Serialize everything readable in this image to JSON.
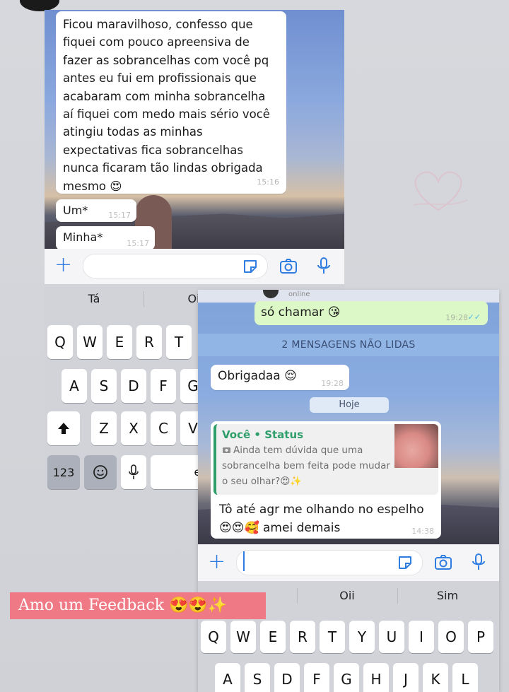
{
  "screenshot1": {
    "messages": [
      {
        "text": "Ficou maravilhoso, confesso que fiquei com pouco apreensiva de fazer as sobrancelhas com você pq antes eu fui em profissionais que acabaram com minha sobrancelha aí fiquei com medo mais sério você atingiu todas as minhas expectativas fica sobrancelhas nunca ficaram tão lindas obrigada mesmo 😍",
        "time": "15:16"
      },
      {
        "text": "Um*",
        "time": "15:17"
      },
      {
        "text": "Minha*",
        "time": "15:17"
      }
    ],
    "suggestions": [
      "Tá",
      "Oi"
    ],
    "keys_row1": [
      "Q",
      "W",
      "E",
      "R",
      "T"
    ],
    "keys_row2": [
      "A",
      "S",
      "D",
      "F",
      "G"
    ],
    "keys_row3": [
      "Z",
      "X",
      "C",
      "V"
    ],
    "key_123": "123",
    "key_space_partial": "es"
  },
  "screenshot2": {
    "header_status": "online",
    "outgoing": {
      "text": "só chamar 😘",
      "time": "19:28",
      "ticks": "✓✓"
    },
    "unread_banner": "2 MENSAGENS NÃO LIDAS",
    "incoming1": {
      "text": "Obrigadaa 😌",
      "time": "19:28"
    },
    "date_chip": "Hoje",
    "reply": {
      "quote_author": "Você • Status",
      "quote_text": "Ainda tem dúvida que uma sobrancelha bem feita pode mudar o seu olhar?😍✨",
      "text": "Tô até agr me olhando no espelho 😍😍🥰 amei demais",
      "time": "14:38"
    },
    "suggestions": [
      "Oii",
      "Sim"
    ],
    "keys_row1": [
      "Q",
      "W",
      "E",
      "R",
      "T",
      "Y",
      "U",
      "I",
      "O",
      "P"
    ],
    "keys_row2": [
      "A",
      "S",
      "D",
      "F",
      "G",
      "H",
      "J",
      "K",
      "L"
    ]
  },
  "feedback_caption": "Amo um Feedback 😍😍✨",
  "colors": {
    "accent_blue": "#2f7de1",
    "outgoing_bubble": "#dcf8c6",
    "caption_bg": "#ef7a85",
    "status_green": "#2e9e6a"
  },
  "icons": [
    "plus-icon",
    "sticker-icon",
    "camera-icon",
    "microphone-icon",
    "shift-icon",
    "emoji-icon",
    "dictation-icon"
  ]
}
